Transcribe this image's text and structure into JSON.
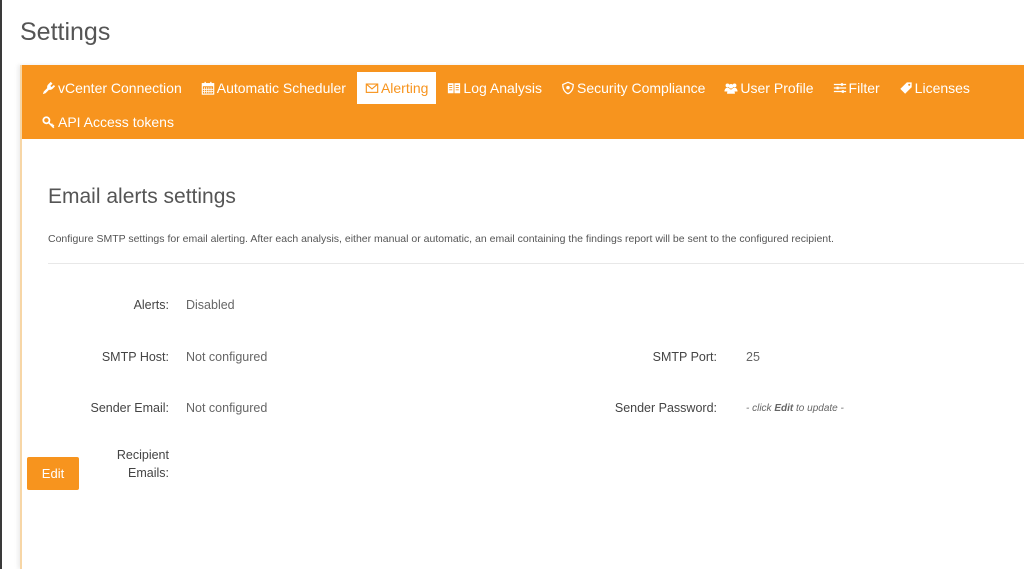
{
  "page": {
    "title": "Settings"
  },
  "tabs": [
    {
      "id": "vcenter",
      "label": "vCenter Connection",
      "icon": "plug-icon",
      "active": false
    },
    {
      "id": "scheduler",
      "label": "Automatic Scheduler",
      "icon": "calendar-icon",
      "active": false
    },
    {
      "id": "alerting",
      "label": "Alerting",
      "icon": "envelope-icon",
      "active": true
    },
    {
      "id": "log",
      "label": "Log Analysis",
      "icon": "book-icon",
      "active": false
    },
    {
      "id": "security",
      "label": "Security Compliance",
      "icon": "shield-icon",
      "active": false
    },
    {
      "id": "user",
      "label": "User Profile",
      "icon": "users-icon",
      "active": false
    },
    {
      "id": "filter",
      "label": "Filter",
      "icon": "sliders-icon",
      "active": false
    },
    {
      "id": "licenses",
      "label": "Licenses",
      "icon": "tag-icon",
      "active": false
    },
    {
      "id": "api",
      "label": "API Access tokens",
      "icon": "key-icon",
      "active": false
    }
  ],
  "section": {
    "title": "Email alerts settings",
    "description": "Configure SMTP settings for email alerting. After each analysis, either manual or automatic, an email containing the findings report will be sent to the configured recipient."
  },
  "fields": {
    "alerts": {
      "label": "Alerts:",
      "value": "Disabled"
    },
    "smtp_host": {
      "label": "SMTP Host:",
      "value": "Not configured"
    },
    "smtp_port": {
      "label": "SMTP Port:",
      "value": "25"
    },
    "sender_email": {
      "label": "Sender Email:",
      "value": "Not configured"
    },
    "sender_password": {
      "label": "Sender Password:",
      "value_prefix": "- click ",
      "value_bold": "Edit",
      "value_suffix": " to update -"
    },
    "recipient_emails": {
      "label_line1": "Recipient",
      "label_line2": "Emails:",
      "value": ""
    }
  },
  "actions": {
    "edit_label": "Edit"
  },
  "colors": {
    "accent": "#f7941e",
    "panel_border": "#f7d6a6"
  }
}
